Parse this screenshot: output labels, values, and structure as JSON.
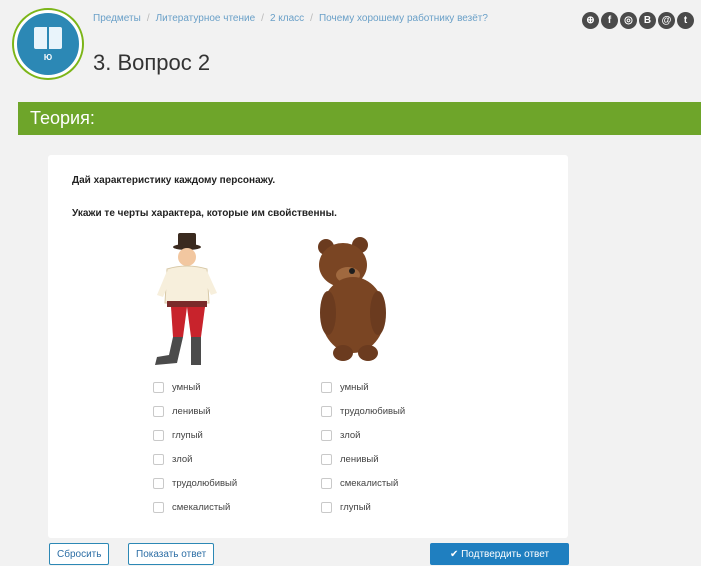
{
  "header": {
    "logo_text": "Ю",
    "breadcrumb": [
      "Предметы",
      "Литературное чтение",
      "2 класс",
      "Почему хорошему работнику везёт?"
    ],
    "title": "3. Вопрос 2",
    "social_icons": [
      "share-icon",
      "facebook-icon",
      "ok-icon",
      "vk-icon",
      "mail-icon",
      "twitter-icon"
    ]
  },
  "theory": {
    "label": "Теория:"
  },
  "question": {
    "line1": "Дай характеристику каждому персонажу.",
    "line2": "Укажи те черты характера, которые им свойственны."
  },
  "characters": [
    {
      "name": "man",
      "options": [
        "умный",
        "ленивый",
        "глупый",
        "злой",
        "трудолюбивый",
        "смекалистый"
      ]
    },
    {
      "name": "bear",
      "options": [
        "умный",
        "трудолюбивый",
        "злой",
        "ленивый",
        "смекалистый",
        "глупый"
      ]
    }
  ],
  "buttons": {
    "reset": "Сбросить",
    "show_answer": "Показать ответ",
    "confirm": "✔ Подтвердить ответ"
  },
  "colors": {
    "theory_bar": "#6ea52a",
    "primary": "#1f7fc0",
    "link": "#6aa0c8"
  }
}
